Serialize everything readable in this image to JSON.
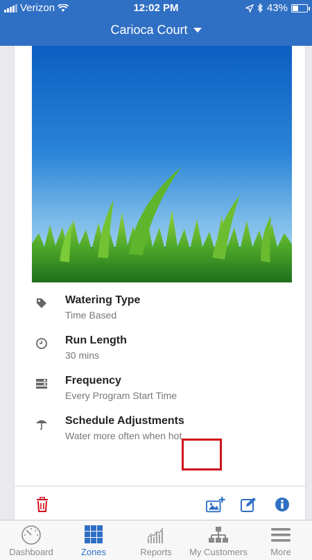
{
  "status_bar": {
    "carrier": "Verizon",
    "time": "12:02 PM",
    "battery": "43%",
    "battery_level": 0.43
  },
  "header": {
    "title": "Carioca Court"
  },
  "zone": {
    "details": [
      {
        "icon": "tag-icon",
        "title": "Watering Type",
        "value": "Time Based"
      },
      {
        "icon": "clock-icon",
        "title": "Run Length",
        "value": "30 mins"
      },
      {
        "icon": "frequency-icon",
        "title": "Frequency",
        "value": "Every Program Start Time"
      },
      {
        "icon": "umbrella-icon",
        "title": "Schedule Adjustments",
        "value": "Water more often when hot"
      }
    ]
  },
  "actions": {
    "delete": "trash-icon",
    "add_photo": "add-photo-icon",
    "edit": "edit-icon",
    "info": "info-icon"
  },
  "tabs": [
    {
      "label": "Dashboard",
      "icon": "gauge-icon",
      "active": false
    },
    {
      "label": "Zones",
      "icon": "grid-icon",
      "active": true
    },
    {
      "label": "Reports",
      "icon": "chart-icon",
      "active": false
    },
    {
      "label": "My Customers",
      "icon": "org-chart-icon",
      "active": false
    },
    {
      "label": "More",
      "icon": "menu-icon",
      "active": false
    }
  ],
  "colors": {
    "brand_blue": "#2f6fc4",
    "delete_red": "#d0101b",
    "highlight_red": "#d0101b"
  }
}
